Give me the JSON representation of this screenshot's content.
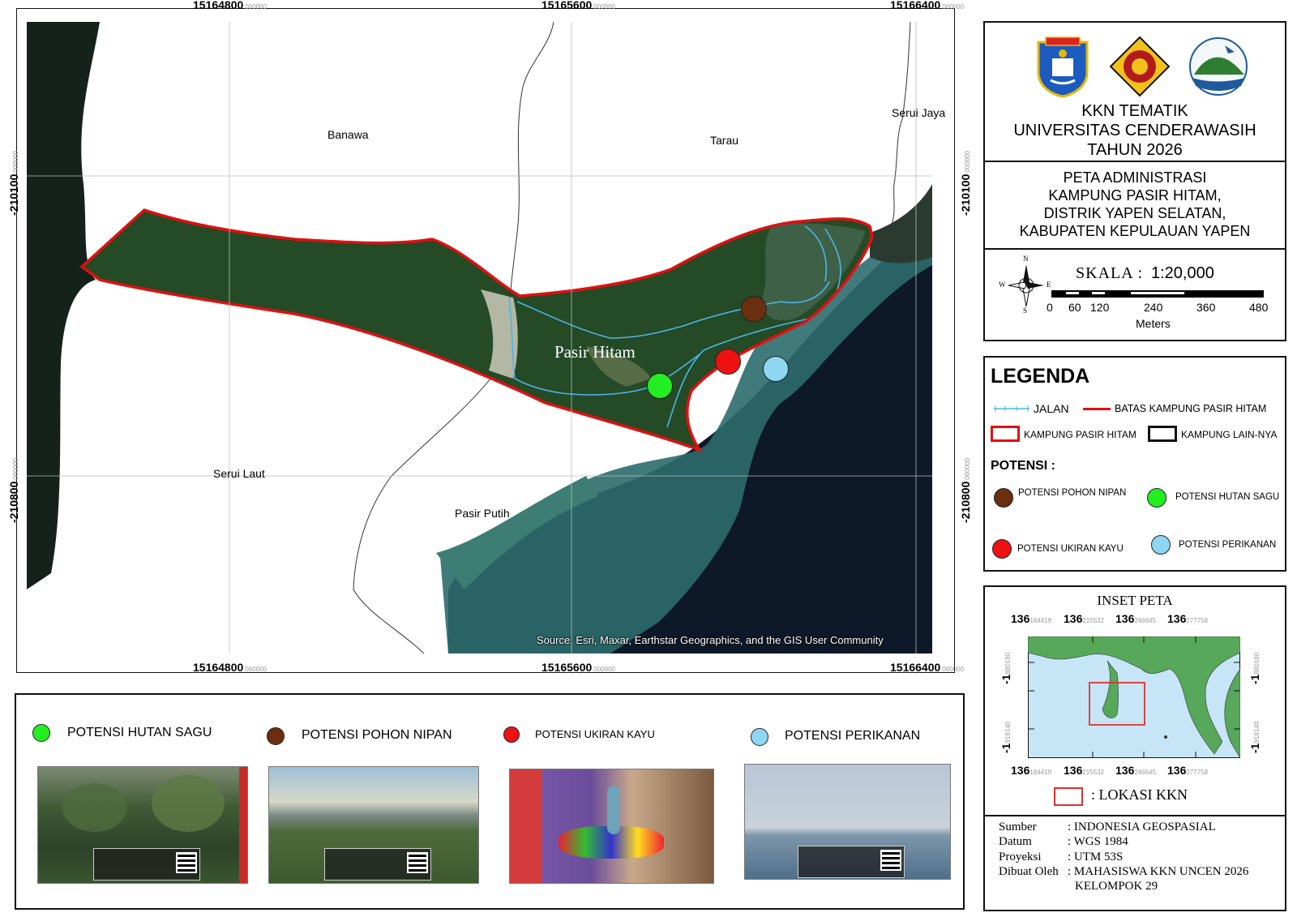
{
  "map": {
    "top_coords": [
      {
        "main": "15164800",
        "sub": "000000"
      },
      {
        "main": "15165600",
        "sub": "000000"
      },
      {
        "main": "15166400",
        "sub": "000000"
      }
    ],
    "bottom_coords": [
      {
        "main": "15164800",
        "sub": "000000"
      },
      {
        "main": "15165600",
        "sub": "000000"
      },
      {
        "main": "15166400",
        "sub": "000000"
      }
    ],
    "left_coords": [
      {
        "main": "-210100",
        "sub": "000000"
      },
      {
        "main": "-210800",
        "sub": "000000"
      }
    ],
    "right_coords": [
      {
        "main": "-210100",
        "sub": "000000"
      },
      {
        "main": "-210800",
        "sub": "000000"
      }
    ],
    "place_labels": {
      "banawa": "Banawa",
      "tarau": "Tarau",
      "serui_jaya": "Serui Jaya",
      "serui_laut": "Serui Laut",
      "pasir_putih": "Pasir Putih",
      "pasir_hitam": "Pasir Hitam"
    },
    "source": "Source: Esri, Maxar, Earthstar Geographics, and the GIS User Community",
    "colors": {
      "boundary": "#e01010",
      "road": "#4db6e8",
      "sea_deep": "#0e1b2b",
      "reef": "#2c6b6b",
      "forest": "#234a24"
    }
  },
  "title_box": {
    "line1": "KKN TEMATIK",
    "line2": "UNIVERSITAS CENDERAWASIH",
    "line3": "TAHUN 2026",
    "logos": [
      "kabupaten-yapen-emblem",
      "universitas-cenderawasih-seal",
      "island-logo"
    ]
  },
  "map_title": {
    "line1": "PETA  ADMINISTRASI",
    "line2": "KAMPUNG PASIR HITAM,",
    "line3": "DISTRIK YAPEN SELATAN,",
    "line4": "KABUPATEN KEPULAUAN YAPEN"
  },
  "scale": {
    "label": "SKALA :",
    "ratio": "1:20,000",
    "ticks": [
      "0",
      "60",
      "120",
      "240",
      "360",
      "480"
    ],
    "unit": "Meters",
    "compass": {
      "n": "N",
      "s": "S",
      "e": "E",
      "w": "W"
    }
  },
  "legend": {
    "title": "LEGENDA",
    "jalan": "JALAN",
    "batas": "BATAS KAMPUNG PASIR HITAM",
    "kampung": "KAMPUNG PASIR HITAM",
    "kampung_lain": "KAMPUNG LAIN-NYA",
    "potensi_title": "POTENSI :",
    "pohon_nipan": "POTENSI POHON NIPAN",
    "hutan_sagu": "POTENSI HUTAN SAGU",
    "ukiran_kayu": "POTENSI UKIRAN KAYU",
    "perikanan": "POTENSI PERIKANAN",
    "colors": {
      "pohon_nipan": "#6b2f10",
      "hutan_sagu": "#22ee22",
      "ukiran_kayu": "#ee1111",
      "perikanan": "#8fd6f2"
    }
  },
  "photos": {
    "hutan_sagu": "POTENSI HUTAN SAGU",
    "pohon_nipan": "POTENSI POHON NIPAN",
    "ukiran_kayu": "POTENSI UKIRAN KAYU",
    "perikanan": "POTENSI PERIKANAN"
  },
  "inset": {
    "title": "INSET PETA",
    "top_ticks": [
      {
        "main": "136",
        "sub": "184419"
      },
      {
        "main": "136",
        "sub": "215532"
      },
      {
        "main": "136",
        "sub": "246645"
      },
      {
        "main": "136",
        "sub": "277758"
      }
    ],
    "bottom_ticks": [
      {
        "main": "136",
        "sub": "184419"
      },
      {
        "main": "136",
        "sub": "215532"
      },
      {
        "main": "136",
        "sub": "246645"
      },
      {
        "main": "136",
        "sub": "277758"
      }
    ],
    "side_ticks": [
      {
        "main": "-1",
        "sub": "880180"
      },
      {
        "main": "-1",
        "sub": "918140"
      }
    ],
    "lokasi": ": LOKASI KKN",
    "colors": {
      "land": "#57a85a",
      "sea": "#c6e6f7",
      "box": "#e03030"
    }
  },
  "info": {
    "rows": [
      {
        "k": "Sumber",
        "v": ": INDONESIA GEOSPASIAL"
      },
      {
        "k": "Datum",
        "v": ": WGS 1984"
      },
      {
        "k": "Proyeksi",
        "v": ": UTM 53S"
      },
      {
        "k": "Dibuat Oleh",
        "v": ": MAHASISWA KKN UNCEN 2026"
      },
      {
        "k": "",
        "v": "KELOMPOK 29"
      }
    ]
  }
}
